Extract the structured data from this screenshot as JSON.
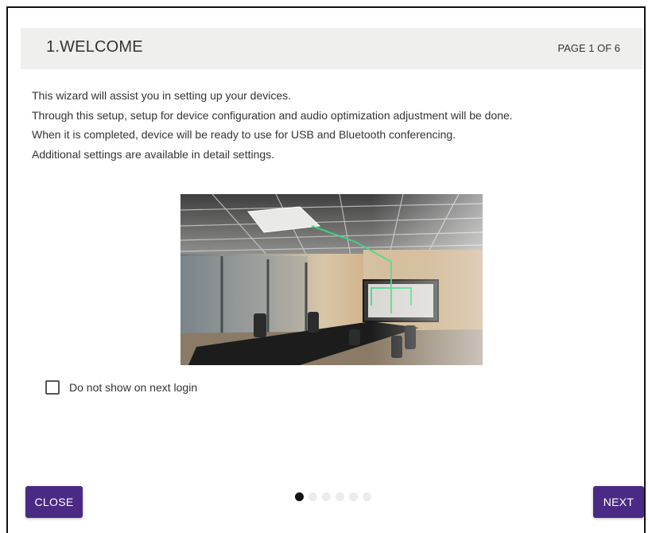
{
  "header": {
    "title": "1.WELCOME",
    "page_indicator": "PAGE 1 OF 6"
  },
  "body": {
    "lines": [
      "This wizard will assist you in setting up your devices.",
      "Through this setup, setup for device configuration and audio optimization adjustment will be done.",
      "When it is completed, device will be ready to use for USB and Bluetooth conferencing.",
      "Additional settings are available in detail settings."
    ]
  },
  "checkbox": {
    "label": "Do not show on next login",
    "checked": false
  },
  "footer": {
    "close_label": "CLOSE",
    "next_label": "NEXT",
    "pagination": {
      "total": 6,
      "current": 1
    }
  },
  "colors": {
    "button_bg": "#4b2a86",
    "header_bg": "#efefee",
    "active_dot": "#111111",
    "inactive_dot": "#ececec",
    "ceiling_mic_beam": "#3ddc84"
  }
}
